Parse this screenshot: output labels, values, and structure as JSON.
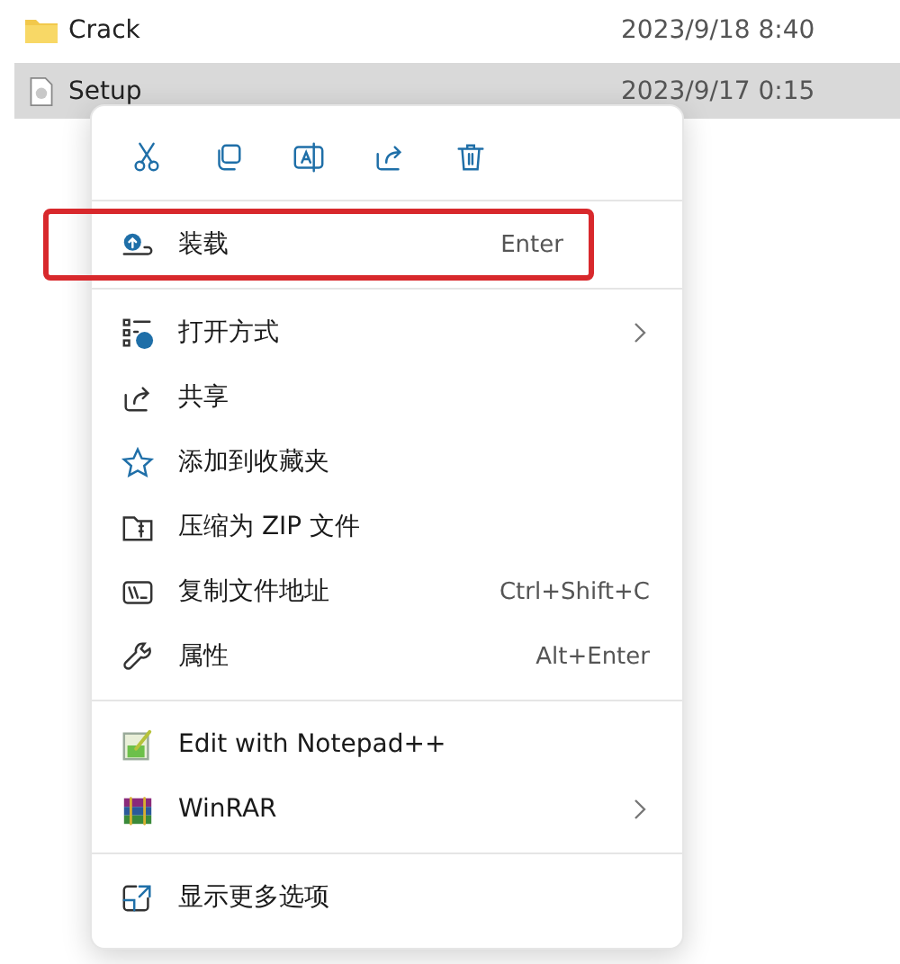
{
  "files": [
    {
      "kind": "folder",
      "name": "Crack",
      "date": "2023/9/18 8:40",
      "selected": false
    },
    {
      "kind": "file",
      "name": "Setup",
      "date": "2023/9/17 0:15",
      "selected": true
    }
  ],
  "context_menu": {
    "toolbar": [
      {
        "kind": "cut"
      },
      {
        "kind": "copy"
      },
      {
        "kind": "rename"
      },
      {
        "kind": "share"
      },
      {
        "kind": "delete"
      }
    ],
    "groups": [
      [
        {
          "kind": "mount",
          "label": "装载",
          "shortcut": "Enter",
          "submenu": false,
          "highlighted": true
        }
      ],
      [
        {
          "kind": "open-with",
          "label": "打开方式",
          "submenu": true,
          "highlighted": false
        },
        {
          "kind": "share",
          "label": "共享",
          "submenu": false,
          "highlighted": false
        },
        {
          "kind": "star",
          "label": "添加到收藏夹",
          "submenu": false,
          "highlighted": false
        },
        {
          "kind": "zip",
          "label": "压缩为 ZIP 文件",
          "submenu": false,
          "highlighted": false
        },
        {
          "kind": "path",
          "label": "复制文件地址",
          "shortcut": "Ctrl+Shift+C",
          "submenu": false,
          "highlighted": false
        },
        {
          "kind": "wrench",
          "label": "属性",
          "shortcut": "Alt+Enter",
          "submenu": false,
          "highlighted": false
        }
      ],
      [
        {
          "kind": "notepad",
          "label": "Edit with Notepad++",
          "submenu": false,
          "highlighted": false
        },
        {
          "kind": "winrar",
          "label": "WinRAR",
          "submenu": true,
          "highlighted": false
        }
      ],
      [
        {
          "kind": "more",
          "label": "显示更多选项",
          "submenu": false,
          "highlighted": false
        }
      ]
    ]
  }
}
